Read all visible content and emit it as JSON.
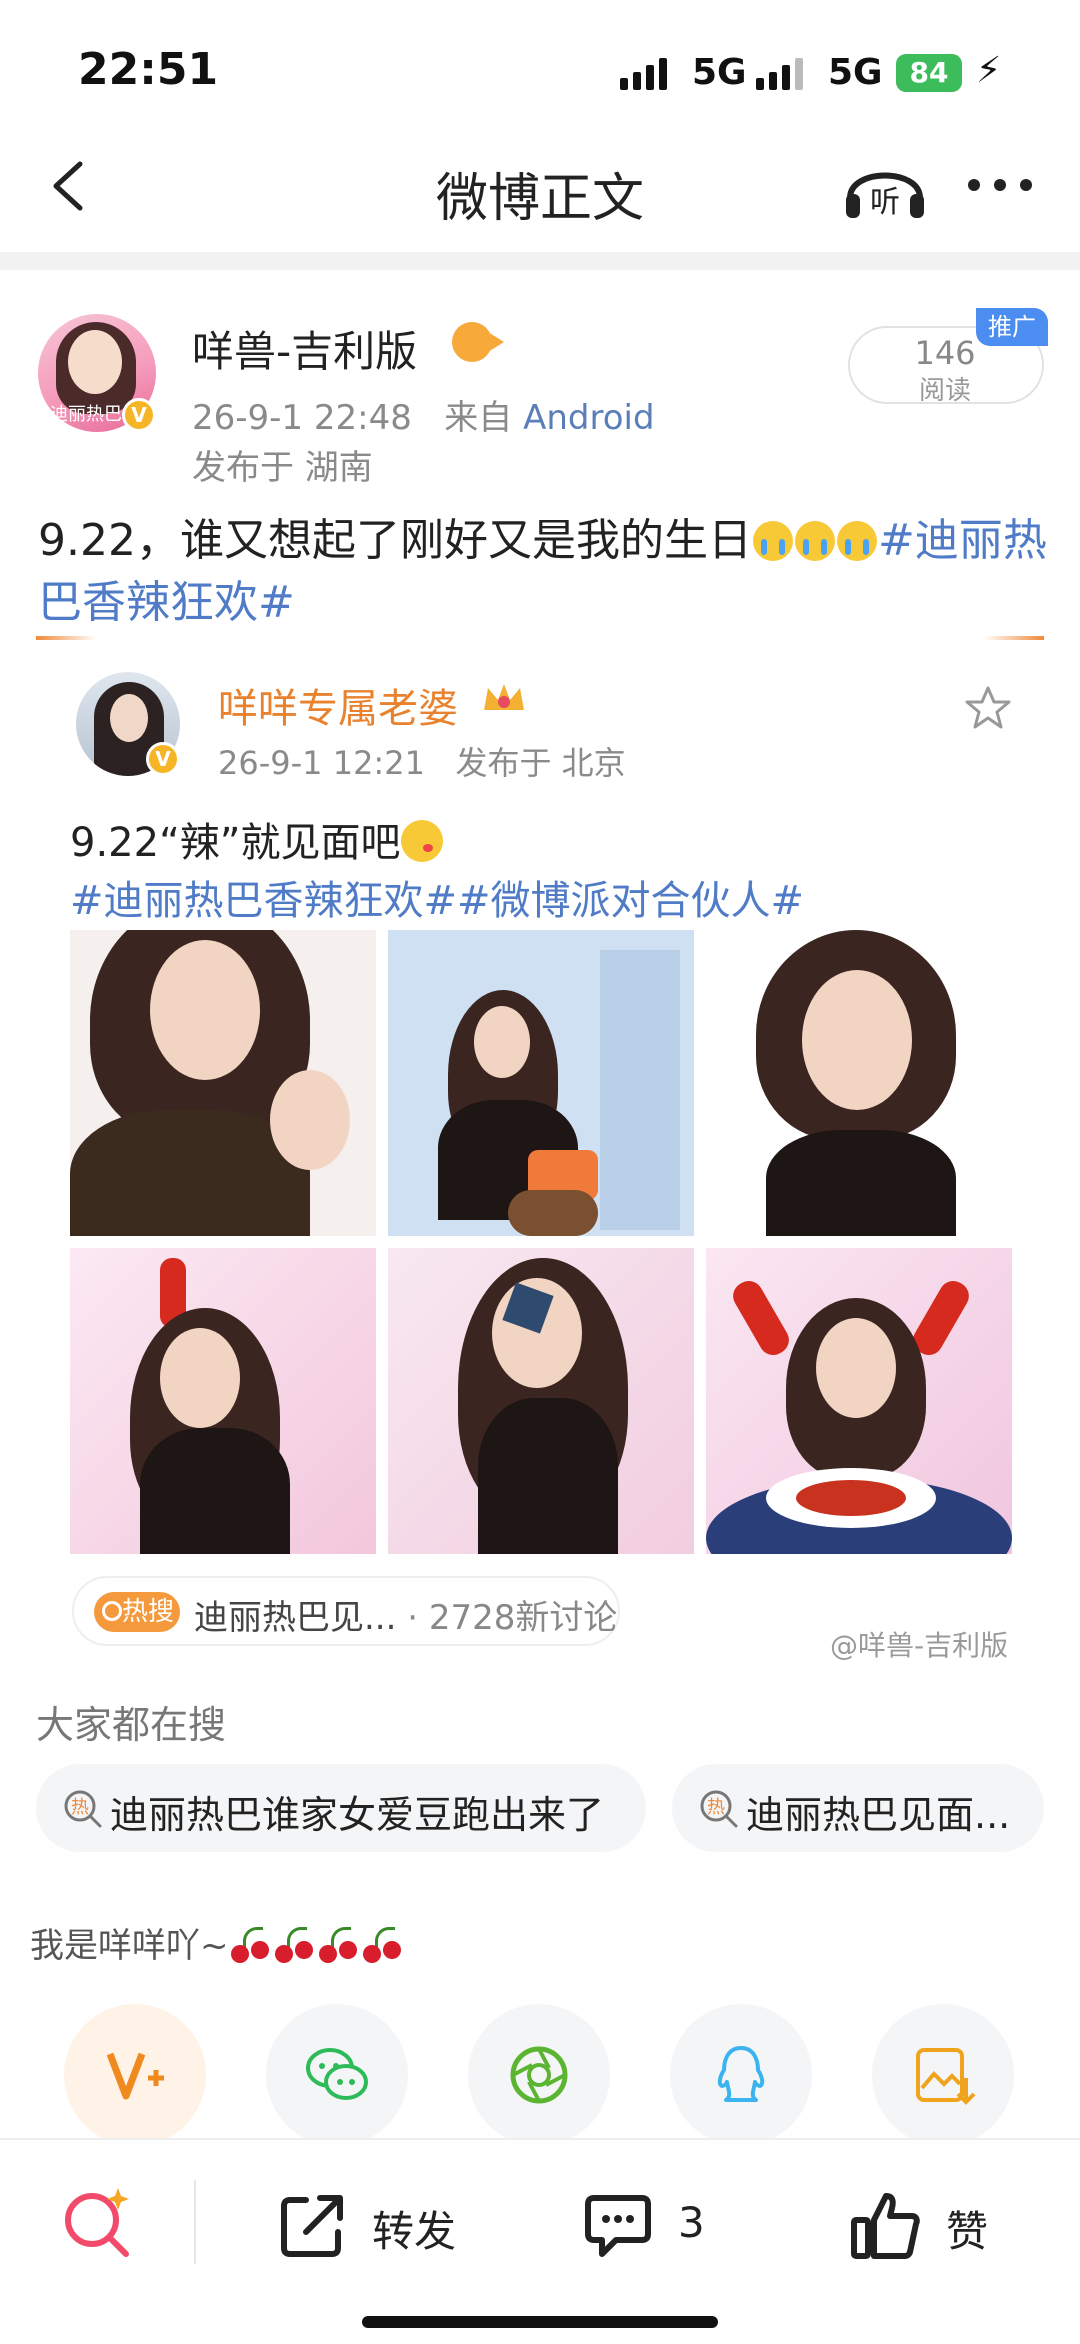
{
  "status_bar": {
    "time": "22:51",
    "network1": "5G",
    "network2": "5G",
    "battery": "84"
  },
  "nav": {
    "title": "微博正文",
    "listen_label": "听"
  },
  "post": {
    "author": "咩兽-吉利版",
    "avatar_text": "迪丽热巴",
    "timestamp": "26-9-1 22:48",
    "source_prefix": "来自",
    "source": "Android",
    "location": "发布于 湖南",
    "reads_count": "146",
    "reads_label": "阅读",
    "promo_badge": "推广",
    "text_main": "9.22，谁又想起了刚好又是我的生日",
    "text_hashtag": "#迪丽热巴香辣狂欢#"
  },
  "repost": {
    "author": "咩咩专属老婆",
    "timestamp": "26-9-1 12:21",
    "location": "发布于 北京",
    "text_line1": "9.22“辣”就见面吧",
    "text_hashtags": "#迪丽热巴香辣狂欢##微博派对合伙人#",
    "hot_tag": "热搜",
    "hot_topic": "迪丽热巴见...",
    "hot_count": "· 2728新讨论",
    "watermark": "@咩兽-吉利版"
  },
  "searching": {
    "title": "大家都在搜",
    "chips": [
      {
        "label": "迪丽热巴谁家女爱豆跑出来了"
      },
      {
        "label": "迪丽热巴见面..."
      }
    ]
  },
  "share": {
    "title": "我是咩咩吖~"
  },
  "bottom_bar": {
    "repost_label": "转发",
    "comment_count": "3",
    "like_label": "赞"
  },
  "colors": {
    "accent_orange": "#e8822e",
    "link_blue": "#4f7bc7",
    "vip_gold": "#f6b526",
    "promo_blue": "#4b8df0"
  }
}
